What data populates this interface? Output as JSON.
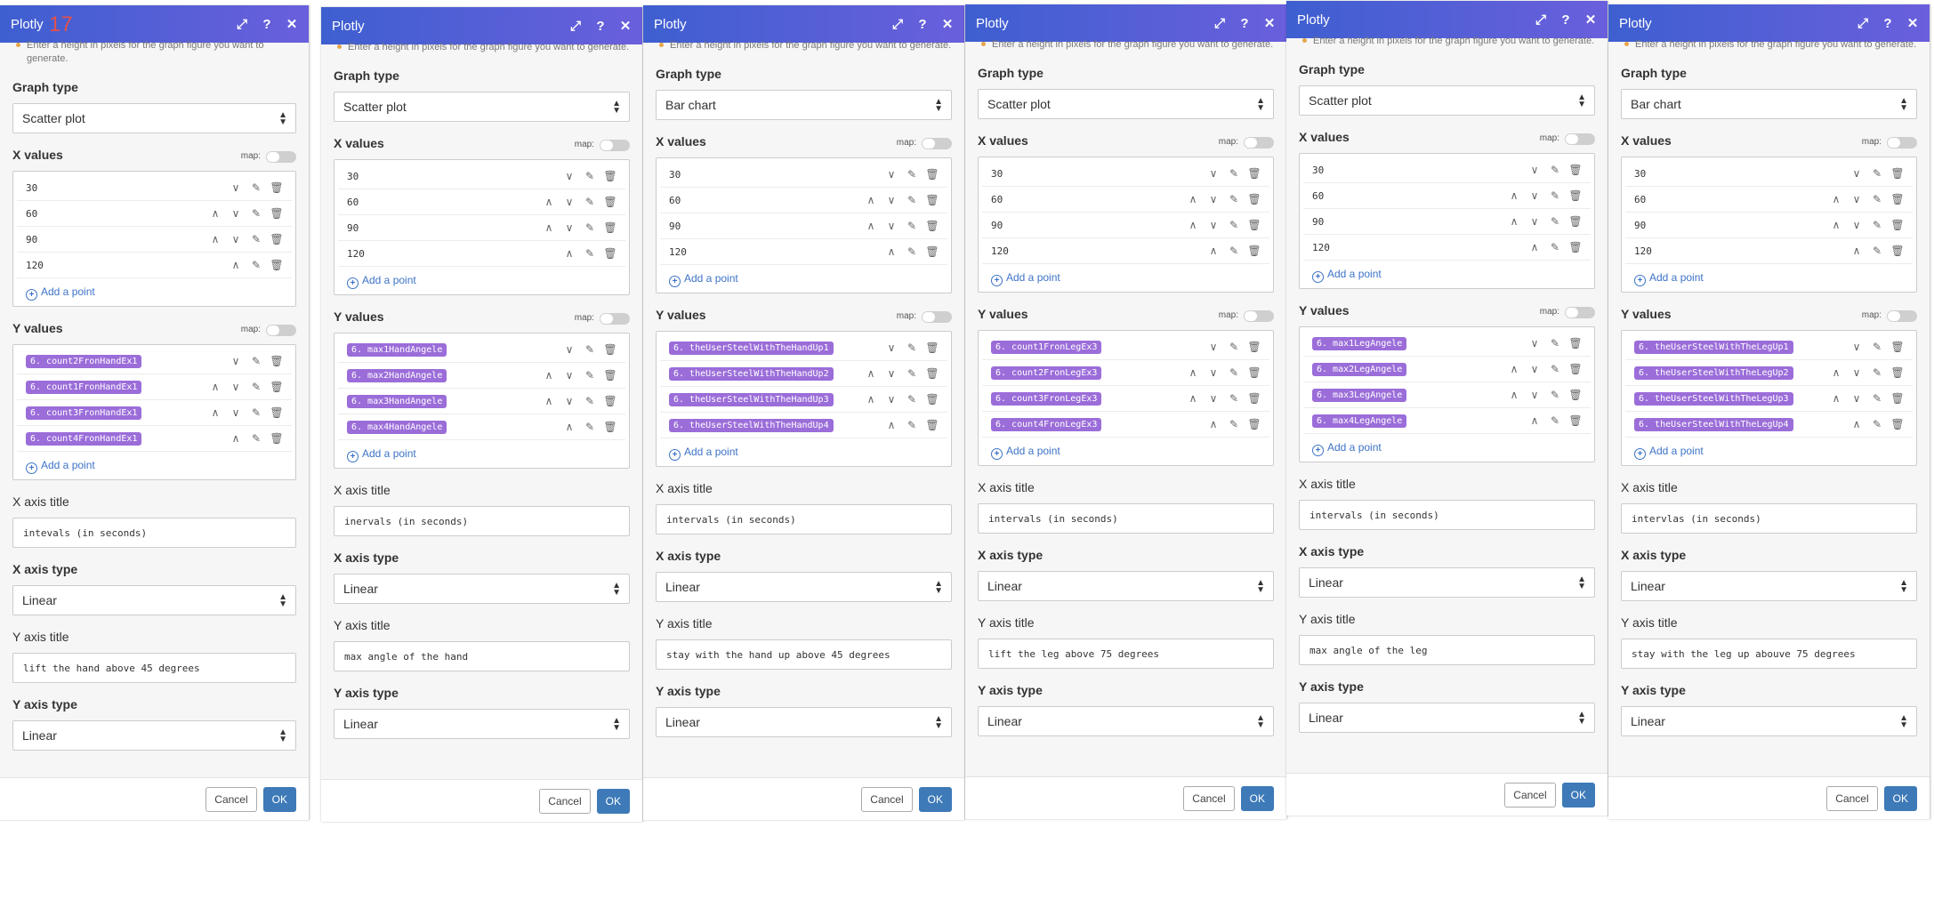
{
  "common": {
    "app_title": "Plotly",
    "badge": "17",
    "hint": "Enter a height in pixels for the graph figure you want to generate.",
    "graph_type_label": "Graph type",
    "x_values_label": "X values",
    "y_values_label": "Y values",
    "map_label": "map:",
    "add_point": "Add a point",
    "x_axis_title_label": "X axis title",
    "x_axis_type_label": "X axis type",
    "y_axis_title_label": "Y axis title",
    "y_axis_type_label": "Y axis type",
    "cancel": "Cancel",
    "ok": "OK",
    "icons": [
      "expand-icon",
      "help-icon",
      "close-icon"
    ]
  },
  "panels": [
    {
      "graph_type": "Scatter plot",
      "x_values": [
        "30",
        "60",
        "90",
        "120"
      ],
      "y_values": [
        "6. count2FronHandEx1",
        "6. count1FronHandEx1",
        "6. count3FronHandEx1",
        "6. count4FronHandEx1"
      ],
      "x_axis_title": "intevals (in seconds)",
      "x_axis_type": "Linear",
      "y_axis_title": "lift the hand above 45 degrees",
      "y_axis_type": "Linear"
    },
    {
      "graph_type": "Scatter plot",
      "x_values": [
        "30",
        "60",
        "90",
        "120"
      ],
      "y_values": [
        "6. max1HandAngele",
        "6. max2HandAngele",
        "6. max3HandAngele",
        "6. max4HandAngele"
      ],
      "x_axis_title": "inervals (in seconds)",
      "x_axis_type": "Linear",
      "y_axis_title": "max angle of the hand",
      "y_axis_type": "Linear"
    },
    {
      "graph_type": "Bar chart",
      "x_values": [
        "30",
        "60",
        "90",
        "120"
      ],
      "y_values": [
        "6. theUserSteelWithTheHandUp1",
        "6. theUserSteelWithTheHandUp2",
        "6. theUserSteelWithTheHandUp3",
        "6. theUserSteelWithTheHandUp4"
      ],
      "x_axis_title": "intervals (in seconds)",
      "x_axis_type": "Linear",
      "y_axis_title": "stay with the hand up above 45 degrees",
      "y_axis_type": "Linear"
    },
    {
      "graph_type": "Scatter plot",
      "x_values": [
        "30",
        "60",
        "90",
        "120"
      ],
      "y_values": [
        "6. count1FronLegEx3",
        "6. count2FronLegEx3",
        "6. count3FronLegEx3",
        "6. count4FronLegEx3"
      ],
      "x_axis_title": "intervals (in seconds)",
      "x_axis_type": "Linear",
      "y_axis_title": "lift the leg above 75 degrees",
      "y_axis_type": "Linear"
    },
    {
      "graph_type": "Scatter plot",
      "x_values": [
        "30",
        "60",
        "90",
        "120"
      ],
      "y_values": [
        "6. max1LegAngele",
        "6. max2LegAngele",
        "6. max3LegAngele",
        "6. max4LegAngele"
      ],
      "x_axis_title": "intervals (in seconds)",
      "x_axis_type": "Linear",
      "y_axis_title": "max angle of the leg",
      "y_axis_type": "Linear"
    },
    {
      "graph_type": "Bar chart",
      "x_values": [
        "30",
        "60",
        "90",
        "120"
      ],
      "y_values": [
        "6. theUserSteelWithTheLegUp1",
        "6. theUserSteelWithTheLegUp2",
        "6. theUserSteelWithTheLegUp3",
        "6. theUserSteelWithTheLegUp4"
      ],
      "x_axis_title": "intervlas (in seconds)",
      "x_axis_type": "Linear",
      "y_axis_title": "stay with the leg up abouve 75 degrees",
      "y_axis_type": "Linear"
    }
  ]
}
